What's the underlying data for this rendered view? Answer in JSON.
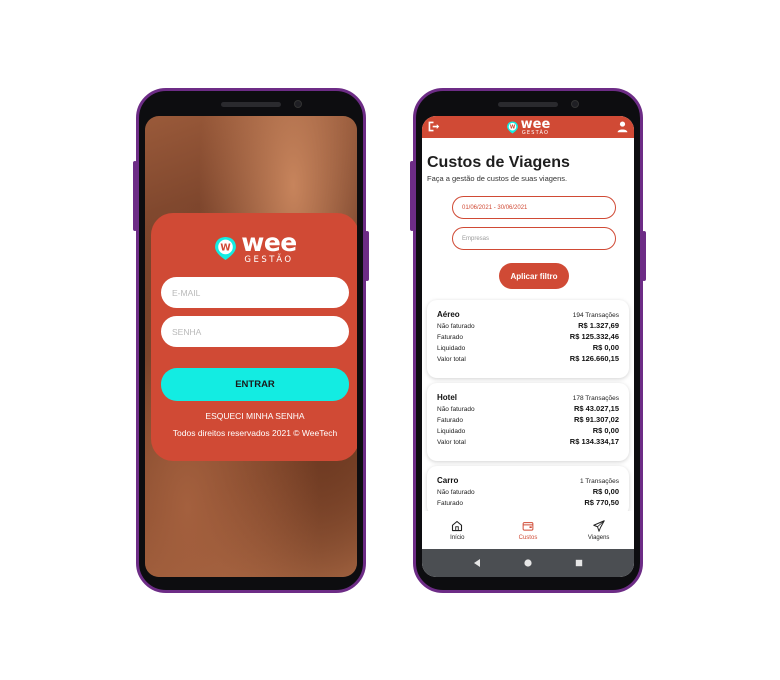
{
  "login": {
    "brand_wee": "wee",
    "brand_gestao": "GESTÃO",
    "email_placeholder": "E-MAIL",
    "password_placeholder": "SENHA",
    "enter_label": "ENTRAR",
    "forgot_label": "ESQUECI MINHA SENHA",
    "rights_text": "Todos direitos reservados 2021 © WeeTech"
  },
  "app": {
    "brand_wee": "wee",
    "brand_gestao": "GESTÃO",
    "title": "Custos de Viagens",
    "subtitle": "Faça a gestão de custos de suas viagens.",
    "date_filter": "01/06/2021 - 30/06/2021",
    "company_placeholder": "Empresas",
    "apply_label": "Aplicar filtro",
    "cards": [
      {
        "title": "Aéreo",
        "count": "194 Transações",
        "rows": [
          {
            "label": "Não faturado",
            "value": "R$ 1.327,69"
          },
          {
            "label": "Faturado",
            "value": "R$ 125.332,46"
          },
          {
            "label": "Liquidado",
            "value": "R$ 0,00"
          },
          {
            "label": "Valor total",
            "value": "R$ 126.660,15"
          }
        ]
      },
      {
        "title": "Hotel",
        "count": "178 Transações",
        "rows": [
          {
            "label": "Não faturado",
            "value": "R$ 43.027,15"
          },
          {
            "label": "Faturado",
            "value": "R$ 91.307,02"
          },
          {
            "label": "Liquidado",
            "value": "R$ 0,00"
          },
          {
            "label": "Valor total",
            "value": "R$ 134.334,17"
          }
        ]
      },
      {
        "title": "Carro",
        "count": "1 Transações",
        "rows": [
          {
            "label": "Não faturado",
            "value": "R$ 0,00"
          },
          {
            "label": "Faturado",
            "value": "R$ 770,50"
          }
        ]
      }
    ],
    "nav": [
      {
        "label": "Início",
        "icon": "home-icon"
      },
      {
        "label": "Custos",
        "icon": "wallet-icon"
      },
      {
        "label": "Viagens",
        "icon": "airplane-icon"
      }
    ],
    "active_nav": "Custos"
  },
  "colors": {
    "brand": "#d04a35",
    "accent": "#13ece2",
    "frame": "#6d2c86"
  }
}
